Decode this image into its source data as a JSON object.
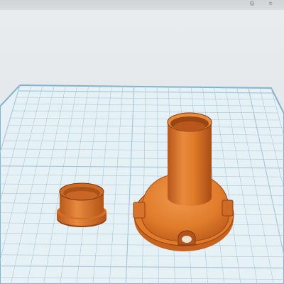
{
  "app": {
    "toolbar_icons": [
      "settings-icon",
      "menu-icon"
    ]
  },
  "workplane": {
    "grid_color": "#a9c8da",
    "plane_color": "#e6f1f6",
    "edge_color": "#7fb4cf",
    "grid": true
  },
  "objects": [
    {
      "name": "ring-cap",
      "color": "#e07b2a"
    },
    {
      "name": "dome-base-with-tube",
      "color": "#e07b2a"
    }
  ]
}
